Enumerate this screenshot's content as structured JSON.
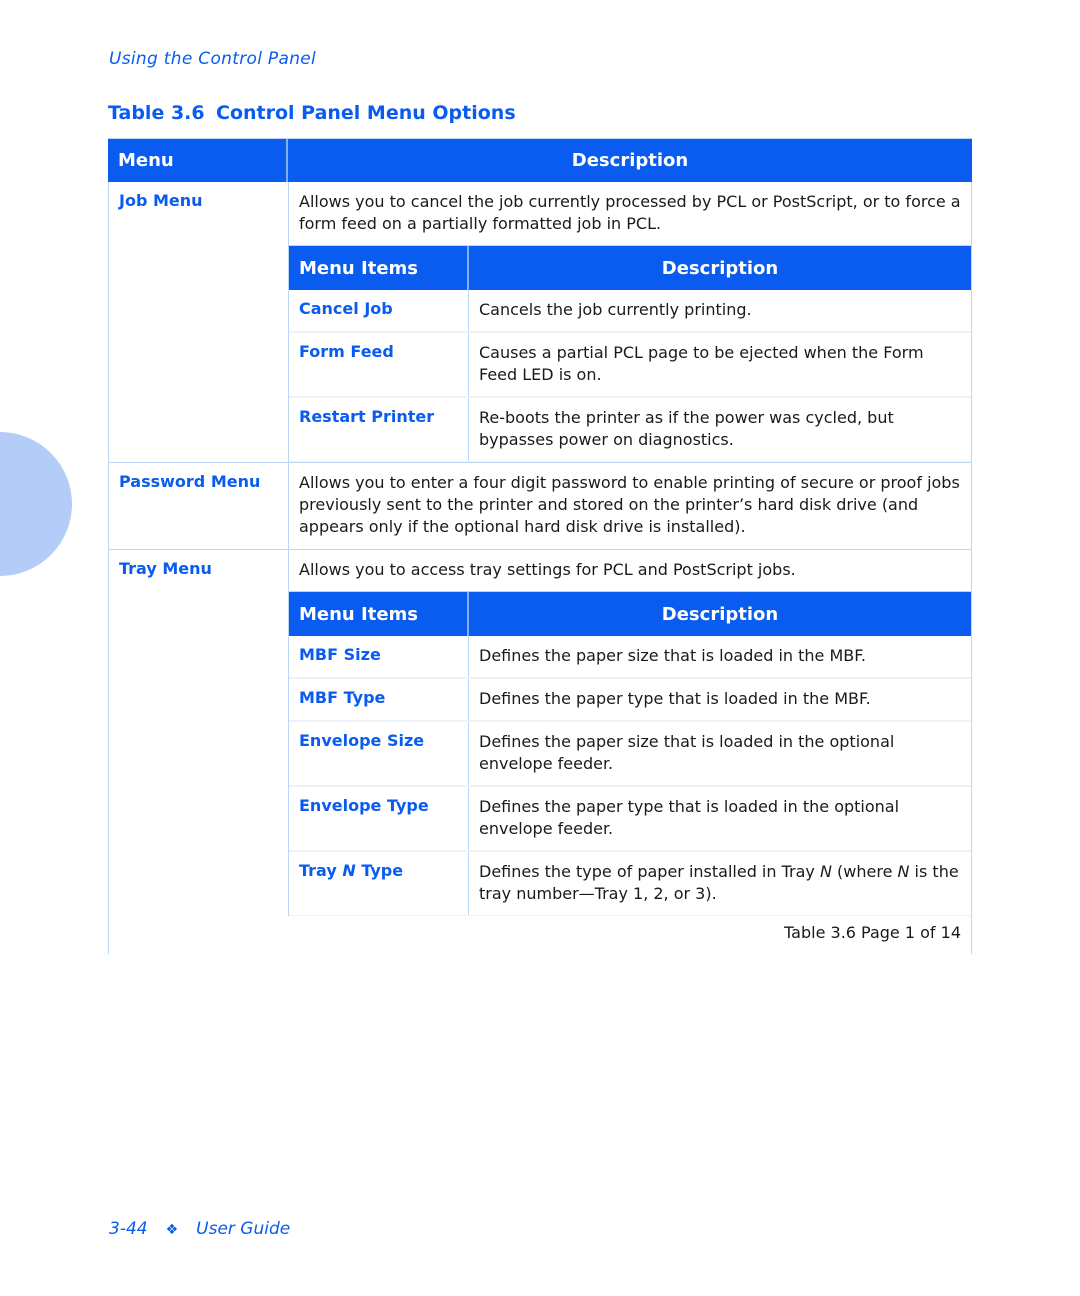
{
  "running_head": "Using the Control Panel",
  "table_title": {
    "number": "Table 3.6",
    "caption": "Control Panel Menu Options"
  },
  "table": {
    "headers": {
      "menu": "Menu",
      "description": "Description"
    },
    "sub_headers": {
      "menu_items": "Menu Items",
      "description": "Description"
    },
    "sections": [
      {
        "menu": "Job Menu",
        "description": "Allows you to cancel the job currently processed by PCL or PostScript, or to force a form feed on a partially formatted job in PCL.",
        "items": [
          {
            "name": "Cancel Job",
            "description": "Cancels the job currently printing."
          },
          {
            "name": "Form Feed",
            "description": "Causes a partial PCL page to be ejected when the Form Feed LED is on."
          },
          {
            "name": "Restart Printer",
            "description": "Re-boots the printer as if the power was cycled, but bypasses power on diagnostics."
          }
        ]
      },
      {
        "menu": "Password Menu",
        "description": "Allows you to enter a four digit password to enable printing of secure or proof jobs previously sent to the printer and stored on the printer’s hard disk drive (and appears only if the optional hard disk drive is installed).",
        "items": []
      },
      {
        "menu": "Tray Menu",
        "description": "Allows you to access tray settings for PCL and PostScript jobs.",
        "items": [
          {
            "name": "MBF Size",
            "description": "Defines the paper size that is loaded in the MBF."
          },
          {
            "name": "MBF Type",
            "description": "Defines the paper type that is loaded in the MBF."
          },
          {
            "name": "Envelope Size",
            "description": "Defines the paper size that is loaded in the optional envelope feeder."
          },
          {
            "name": "Envelope Type",
            "description": "Defines the paper type that is loaded in the optional envelope feeder."
          },
          {
            "name_prefix": "Tray ",
            "name_italic": "N",
            "name_suffix": " Type",
            "desc_parts": [
              "Defines the type of paper installed in Tray ",
              "N",
              " (where ",
              "N",
              " is the tray number—Tray 1, 2, or 3)."
            ]
          }
        ]
      }
    ],
    "footer": "Table 3.6  Page 1 of 14"
  },
  "page_footer": {
    "page_number": "3-44",
    "separator_icon": "❖",
    "title": "User Guide"
  }
}
